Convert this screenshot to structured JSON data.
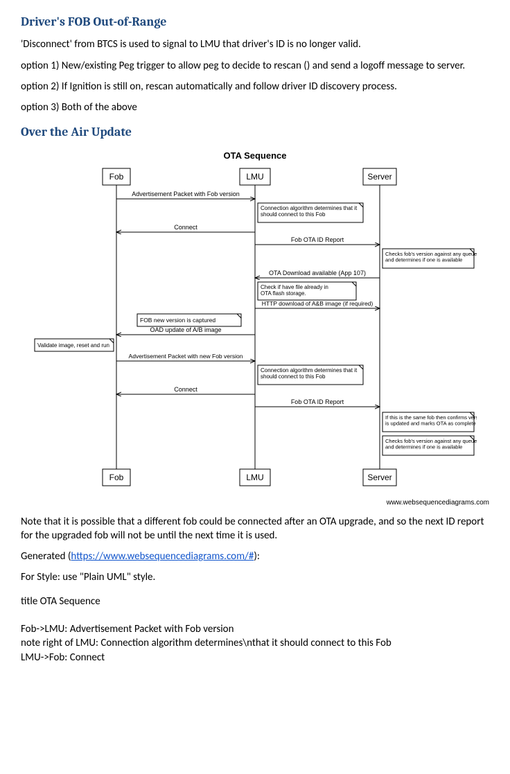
{
  "h1": "Driver's FOB Out-of-Range",
  "p_intro": "'Disconnect' from BTCS is used to signal to LMU that driver's ID is no longer valid.",
  "opt1": "option 1) New/existing Peg trigger to allow peg to decide to rescan () and send a logoff message to server.",
  "opt2": "option 2) If Ignition is still on, rescan automatically and follow driver ID discovery process.",
  "opt3": "option 3) Both of the above",
  "h2": "Over the Air Update",
  "diagram": {
    "title": "OTA Sequence",
    "participants": {
      "fob": "Fob",
      "lmu": "LMU",
      "server": "Server"
    },
    "msg_adv": "Advertisement Packet with Fob version",
    "note_conn1": "Connection algorithm determines that it should connect to this Fob",
    "msg_connect": "Connect",
    "msg_fobota1": "Fob OTA ID Report",
    "note_checkver1": "Checks fob's version against any queued updates and determines if one is available",
    "msg_otadl": "OTA Download available (App 107)",
    "note_checkfile": "Check if have file already in OTA flash storage.",
    "msg_http": "HTTP download of A&B image (if required)",
    "note_fobnew": "FOB new version is captured",
    "msg_oad": "OAD update of A/B image",
    "note_validate": "Validate image, reset and run",
    "msg_adv2": "Advertisement Packet with new Fob version",
    "note_conn2": "Connection algorithm determines that it should connect to this Fob",
    "msg_connect2": "Connect",
    "msg_fobota2": "Fob OTA ID Report",
    "note_confirm": "If this is the same fob then confirms version is updated and marks OTA as complete",
    "note_checkver2": "Checks fob's version against any queued updates and determines if one is available",
    "footer": "www.websequencediagrams.com"
  },
  "p_note": "Note that it is possible that a different fob could be connected after an OTA upgrade, and so the next ID report for the upgraded fob will not be until the next time it is used.",
  "p_gen_prefix": "Generated (",
  "p_gen_link": "https://www.websequencediagrams.com/#",
  "p_gen_suffix": "):",
  "p_style": "For Style: use \"Plain UML\" style.",
  "code_title": "title OTA Sequence",
  "code1": "Fob->LMU: Advertisement Packet with Fob version",
  "code2": "note right of LMU: Connection algorithm determines\\nthat it should connect to this Fob",
  "code3": "LMU->Fob: Connect"
}
